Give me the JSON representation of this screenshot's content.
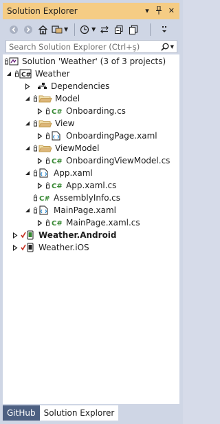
{
  "window": {
    "title": "Solution Explorer",
    "controls": {
      "dropdown": "▾",
      "pin": "ꟻ",
      "close": "✕"
    }
  },
  "toolbar": {
    "icons": [
      "back-icon",
      "forward-icon",
      "home-icon",
      "switch-views-icon",
      "pending-changes-filter-icon",
      "sync-icon",
      "collapse-all-icon",
      "show-all-files-icon"
    ]
  },
  "search": {
    "placeholder": "Search Solution Explorer (Ctrl+ş)"
  },
  "tree": {
    "solution": "Solution 'Weather' (3 of 3 projects)",
    "project": "Weather",
    "dependencies": "Dependencies",
    "model_folder": "Model",
    "model_file": "Onboarding.cs",
    "view_folder": "View",
    "view_file": "OnboardingPage.xaml",
    "viewmodel_folder": "ViewModel",
    "viewmodel_file": "OnboardingViewModel.cs",
    "app_xaml": "App.xaml",
    "app_xaml_cs": "App.xaml.cs",
    "assembly_info": "AssemblyInfo.cs",
    "mainpage_xaml": "MainPage.xaml",
    "mainpage_xaml_cs": "MainPage.xaml.cs",
    "android_project": "Weather.Android",
    "ios_project": "Weather.iOS"
  },
  "tabs": {
    "github": "GitHub",
    "solution_explorer": "Solution Explorer"
  },
  "colors": {
    "title_bar": "#f5cc84",
    "panel_bg": "#cfd6e5",
    "tab_inactive": "#4d6082",
    "csharp_green": "#368832",
    "folder_yellow": "#dcb67a",
    "check_red": "#c42b1c"
  }
}
